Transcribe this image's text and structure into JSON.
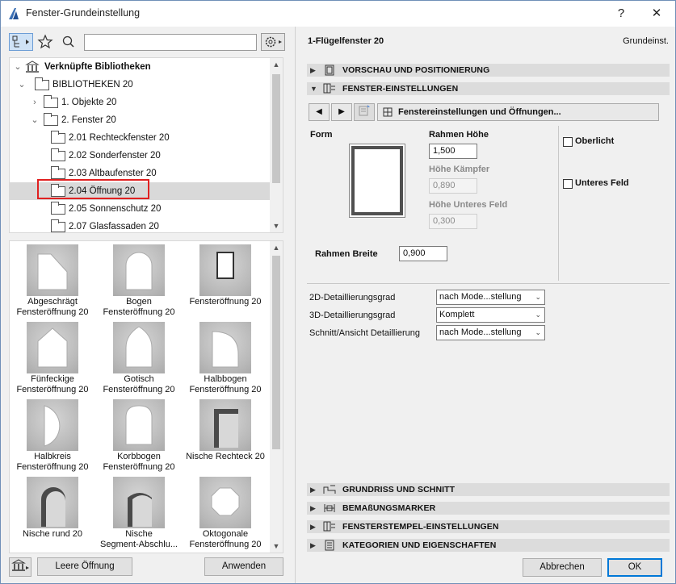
{
  "window": {
    "title": "Fenster-Grundeinstellung",
    "help_label": "?",
    "close_label": "✕"
  },
  "library": {
    "tree": [
      {
        "label": "Verknüpfte Bibliotheken",
        "level": 0,
        "expanded": true,
        "icon": "library-icon"
      },
      {
        "label": "BIBLIOTHEKEN 20",
        "level": 1,
        "expanded": true,
        "icon": "folder-icon"
      },
      {
        "label": "1. Objekte 20",
        "level": 2,
        "expanded": false,
        "icon": "folder-icon"
      },
      {
        "label": "2. Fenster 20",
        "level": 2,
        "expanded": true,
        "icon": "folder-icon"
      },
      {
        "label": "2.01 Rechteckfenster 20",
        "level": 3,
        "icon": "folder-icon"
      },
      {
        "label": "2.02 Sonderfenster 20",
        "level": 3,
        "icon": "folder-icon"
      },
      {
        "label": "2.03 Altbaufenster 20",
        "level": 3,
        "icon": "folder-icon"
      },
      {
        "label": "2.04 Öffnung 20",
        "level": 3,
        "icon": "folder-icon",
        "selected": true
      },
      {
        "label": "2.05 Sonnenschutz 20",
        "level": 3,
        "icon": "folder-icon"
      },
      {
        "label": "2.07 Glasfassaden 20",
        "level": 3,
        "icon": "folder-icon"
      }
    ],
    "gallery": [
      {
        "label": "Abgeschrägt\nFensteröffnung 20",
        "shape": "slanted"
      },
      {
        "label": "Bogen\nFensteröffnung 20",
        "shape": "arch"
      },
      {
        "label": "Fensteröffnung 20",
        "shape": "rect"
      },
      {
        "label": "Fünfeckige\nFensteröffnung 20",
        "shape": "pentagon"
      },
      {
        "label": "Gotisch\nFensteröffnung 20",
        "shape": "gothic"
      },
      {
        "label": "Halbbogen\nFensteröffnung 20",
        "shape": "halfarch"
      },
      {
        "label": "Halbkreis\nFensteröffnung 20",
        "shape": "halfcircle"
      },
      {
        "label": "Korbbogen\nFensteröffnung 20",
        "shape": "basket"
      },
      {
        "label": "Nische Rechteck 20",
        "shape": "niche-rect"
      },
      {
        "label": "Nische rund 20",
        "shape": "niche-round"
      },
      {
        "label": "Nische\nSegment-Abschlu...",
        "shape": "niche-segment"
      },
      {
        "label": "Oktogonale\nFensteröffnung 20",
        "shape": "octagon"
      }
    ],
    "empty_opening_button": "Leere Öffnung",
    "apply_button": "Anwenden"
  },
  "panel": {
    "object_name": "1-Flügelfenster 20",
    "default_label": "Grundeinst.",
    "sections_top": [
      {
        "label": "VORSCHAU UND POSITIONIERUNG",
        "expanded": false,
        "icon": "preview-icon"
      },
      {
        "label": "FENSTER-EINSTELLUNGEN",
        "expanded": true,
        "icon": "window-settings-icon"
      }
    ],
    "page_selector": "Fenstereinstellungen und Öffnungen...",
    "form_label": "Form",
    "frame_height_label": "Rahmen Höhe",
    "frame_height_value": "1,500",
    "transom_height_label": "Höhe Kämpfer",
    "transom_height_value": "0,890",
    "lower_panel_height_label": "Höhe Unteres Feld",
    "lower_panel_height_value": "0,300",
    "frame_width_label": "Rahmen Breite",
    "frame_width_value": "0,900",
    "skylight_label": "Oberlicht",
    "lower_field_label": "Unteres Feld",
    "detail_2d_label": "2D-Detaillierungsgrad",
    "detail_2d_value": "nach Mode...stellung",
    "detail_3d_label": "3D-Detaillierungsgrad",
    "detail_3d_value": "Komplett",
    "section_detail_label": "Schnitt/Ansicht Detaillierung",
    "section_detail_value": "nach Mode...stellung",
    "sections_bottom": [
      {
        "label": "GRUNDRISS UND SCHNITT",
        "expanded": false,
        "icon": "floorplan-icon"
      },
      {
        "label": "BEMAßUNGSMARKER",
        "expanded": false,
        "icon": "dimension-icon"
      },
      {
        "label": "FENSTERSTEMPEL-EINSTELLUNGEN",
        "expanded": false,
        "icon": "stamp-icon"
      },
      {
        "label": "KATEGORIEN UND EIGENSCHAFTEN",
        "expanded": false,
        "icon": "categories-icon"
      }
    ],
    "cancel_button": "Abbrechen",
    "ok_button": "OK"
  },
  "colors": {
    "selection_frame": "#e02020",
    "accent": "#0078d7"
  }
}
